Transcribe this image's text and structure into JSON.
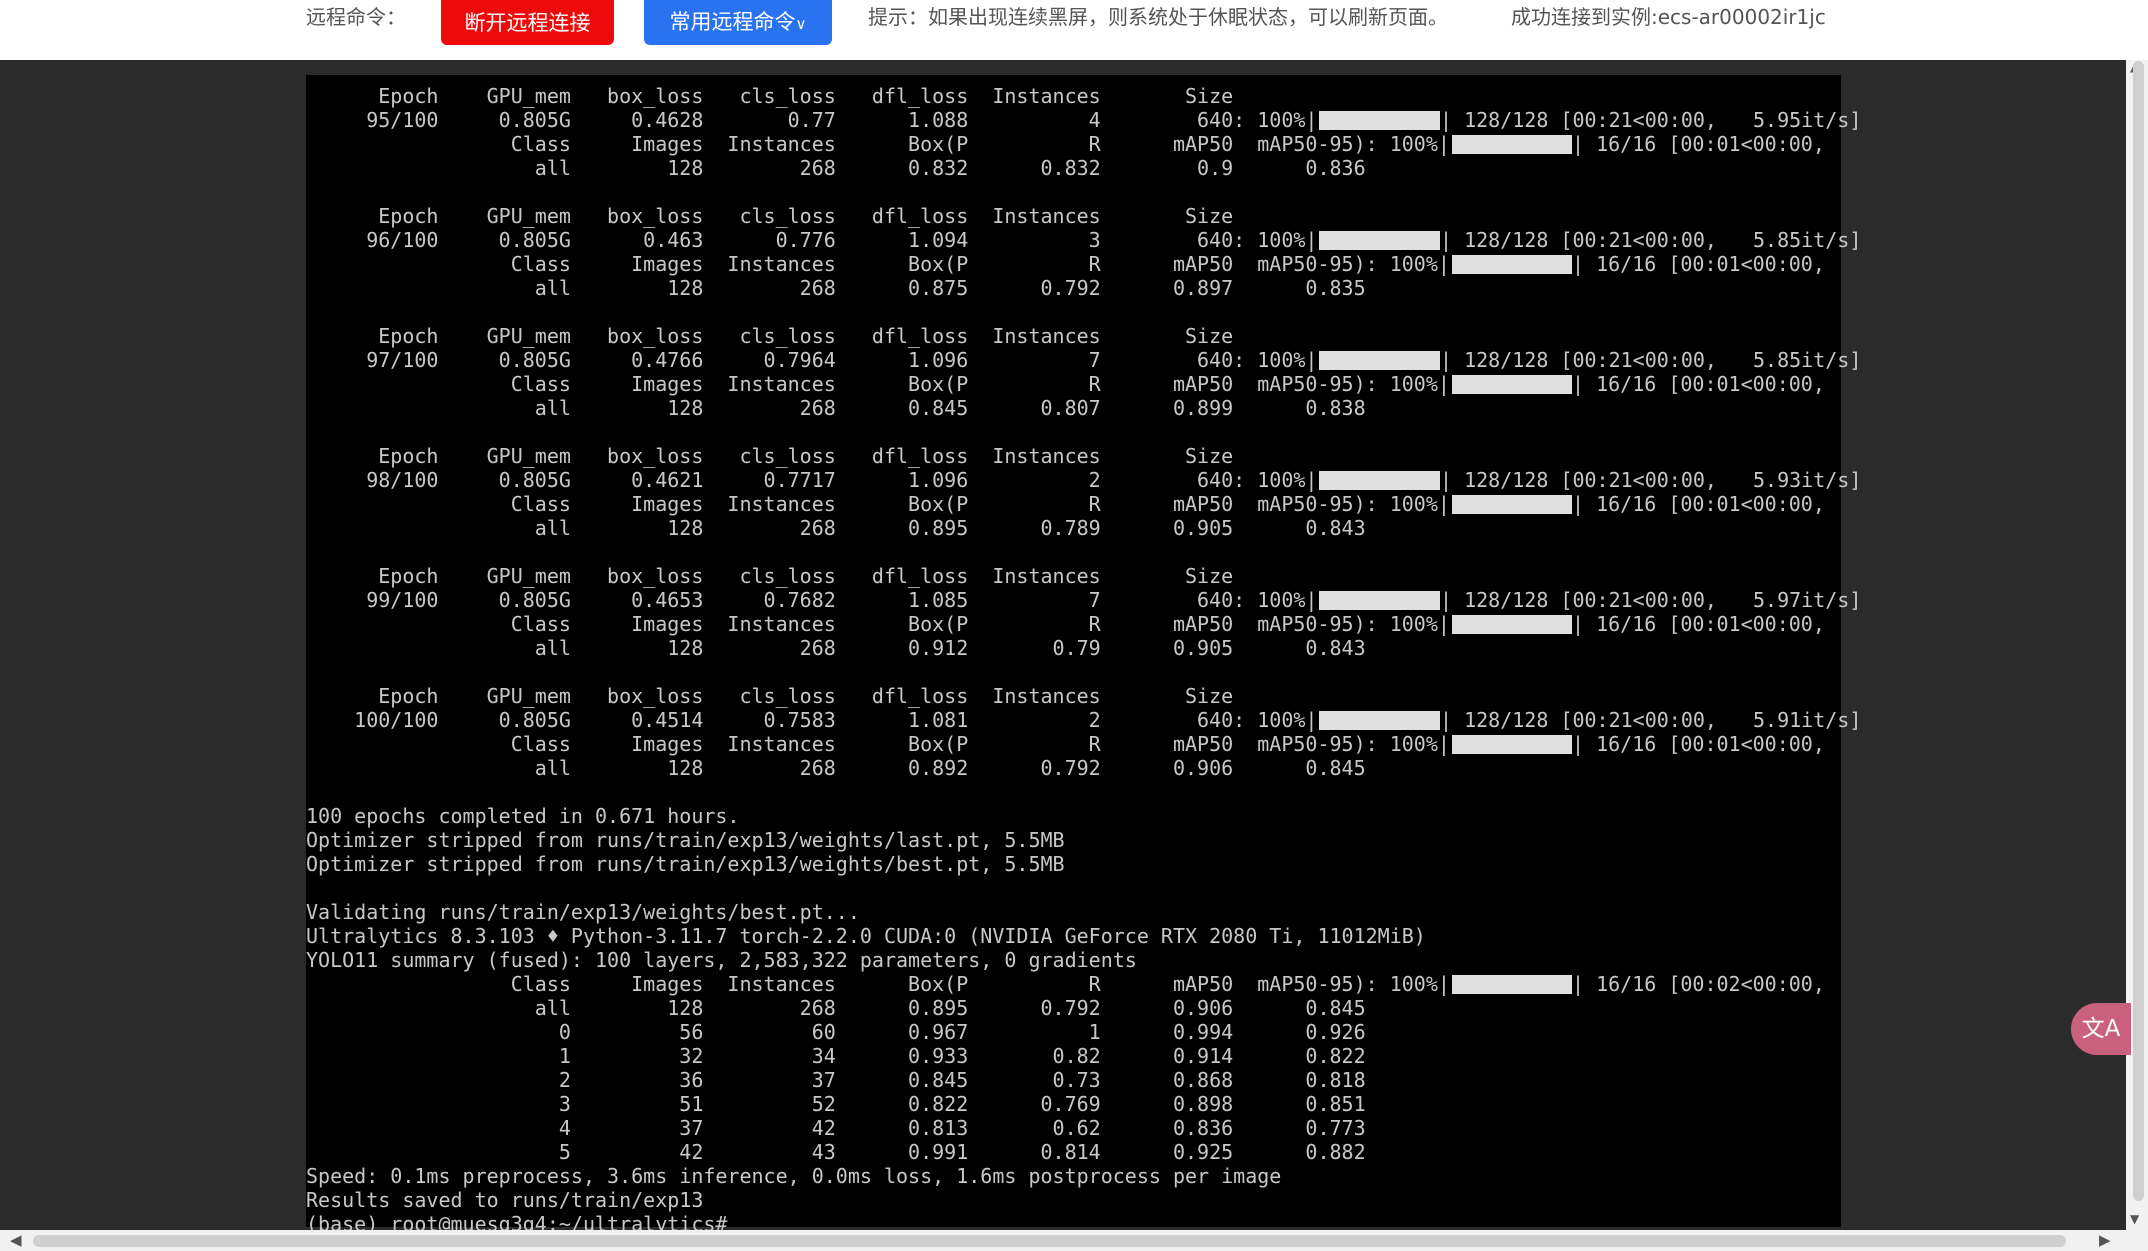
{
  "topbar": {
    "remote_label": "远程命令：",
    "disconnect_button": "断开远程连接",
    "commands_button": "常用远程命令",
    "commands_chevron": "∨",
    "hint": "提示：如果出现连续黑屏，则系统处于休眠状态，可以刷新页面。",
    "connection_status": "成功连接到实例:ecs-ar00002ir1jc"
  },
  "terminal": {
    "lines": [
      "      Epoch    GPU_mem   box_loss   cls_loss   dfl_loss  Instances       Size",
      "     95/100     0.805G     0.4628       0.77      1.088          4        640: 100%|",
      "                 Class     Images  Instances      Box(P          R      mAP50  mAP50-95): 100%|",
      "                   all        128        268      0.832      0.832        0.9      0.836",
      "",
      "      Epoch    GPU_mem   box_loss   cls_loss   dfl_loss  Instances       Size",
      "     96/100     0.805G      0.463      0.776      1.094          3        640: 100%|",
      "                 Class     Images  Instances      Box(P          R      mAP50  mAP50-95): 100%|",
      "                   all        128        268      0.875      0.792      0.897      0.835",
      "",
      "      Epoch    GPU_mem   box_loss   cls_loss   dfl_loss  Instances       Size",
      "     97/100     0.805G     0.4766     0.7964      1.096          7        640: 100%|",
      "                 Class     Images  Instances      Box(P          R      mAP50  mAP50-95): 100%|",
      "                   all        128        268      0.845      0.807      0.899      0.838",
      "",
      "      Epoch    GPU_mem   box_loss   cls_loss   dfl_loss  Instances       Size",
      "     98/100     0.805G     0.4621     0.7717      1.096          2        640: 100%|",
      "                 Class     Images  Instances      Box(P          R      mAP50  mAP50-95): 100%|",
      "                   all        128        268      0.895      0.789      0.905      0.843",
      "",
      "      Epoch    GPU_mem   box_loss   cls_loss   dfl_loss  Instances       Size",
      "     99/100     0.805G     0.4653     0.7682      1.085          7        640: 100%|",
      "                 Class     Images  Instances      Box(P          R      mAP50  mAP50-95): 100%|",
      "                   all        128        268      0.912       0.79      0.905      0.843",
      "",
      "      Epoch    GPU_mem   box_loss   cls_loss   dfl_loss  Instances       Size",
      "    100/100     0.805G     0.4514     0.7583      1.081          2        640: 100%|",
      "                 Class     Images  Instances      Box(P          R      mAP50  mAP50-95): 100%|",
      "                   all        128        268      0.892      0.792      0.906      0.845",
      "",
      "100 epochs completed in 0.671 hours.",
      "Optimizer stripped from runs/train/exp13/weights/last.pt, 5.5MB",
      "Optimizer stripped from runs/train/exp13/weights/best.pt, 5.5MB",
      "",
      "Validating runs/train/exp13/weights/best.pt...",
      "Ultralytics 8.3.103 ♦ Python-3.11.7 torch-2.2.0 CUDA:0 (NVIDIA GeForce RTX 2080 Ti, 11012MiB)",
      "YOLO11 summary (fused): 100 layers, 2,583,322 parameters, 0 gradients",
      "                 Class     Images  Instances      Box(P          R      mAP50  mAP50-95): 100%|",
      "                   all        128        268      0.895      0.792      0.906      0.845",
      "                     0         56         60      0.967          1      0.994      0.926",
      "                     1         32         34      0.933       0.82      0.914      0.822",
      "                     2         36         37      0.845       0.73      0.868      0.818",
      "                     3         51         52      0.822      0.769      0.898      0.851",
      "                     4         37         42      0.813       0.62      0.836      0.773",
      "                     5         42         43      0.991      0.814      0.925      0.882",
      "Speed: 0.1ms preprocess, 3.6ms inference, 0.0ms loss, 1.6ms postprocess per image",
      "Results saved to runs/train/exp13",
      "(base) root@muesg3g4:~/ultralytics# "
    ],
    "train_progress_suffix": "| 128/128 [00:21<00:00,",
    "train_speeds": [
      "5.95it/s]",
      "5.85it/s]",
      "5.85it/s]",
      "5.93it/s]",
      "5.97it/s]",
      "5.91it/s]"
    ],
    "val_progress_suffix": "| 16/16 [00:01<00:00,",
    "final_val_progress_suffix": "| 16/16 [00:02<00:00,"
  },
  "ui": {
    "translate_icon": "translate-icon",
    "translate_glyph": "文A"
  }
}
